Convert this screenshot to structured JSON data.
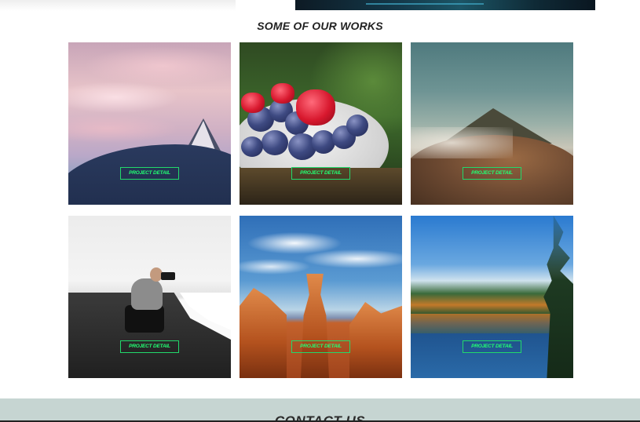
{
  "works": {
    "title": "SOME OF OUR WORKS",
    "items": [
      {
        "image": "mountain-sunset",
        "button": "PROJECT DETAIL"
      },
      {
        "image": "berries-bowl",
        "button": "PROJECT DETAIL"
      },
      {
        "image": "volcano-landscape",
        "button": "PROJECT DETAIL"
      },
      {
        "image": "photographer-beach",
        "button": "PROJECT DETAIL"
      },
      {
        "image": "canyon-hoodoos",
        "button": "PROJECT DETAIL"
      },
      {
        "image": "autumn-lake",
        "button": "PROJECT DETAIL"
      }
    ]
  },
  "contact": {
    "title": "CONTACT US"
  },
  "colors": {
    "button_border": "#22d96b",
    "button_text": "#22ff73",
    "contact_band": "#c6d5d2"
  }
}
